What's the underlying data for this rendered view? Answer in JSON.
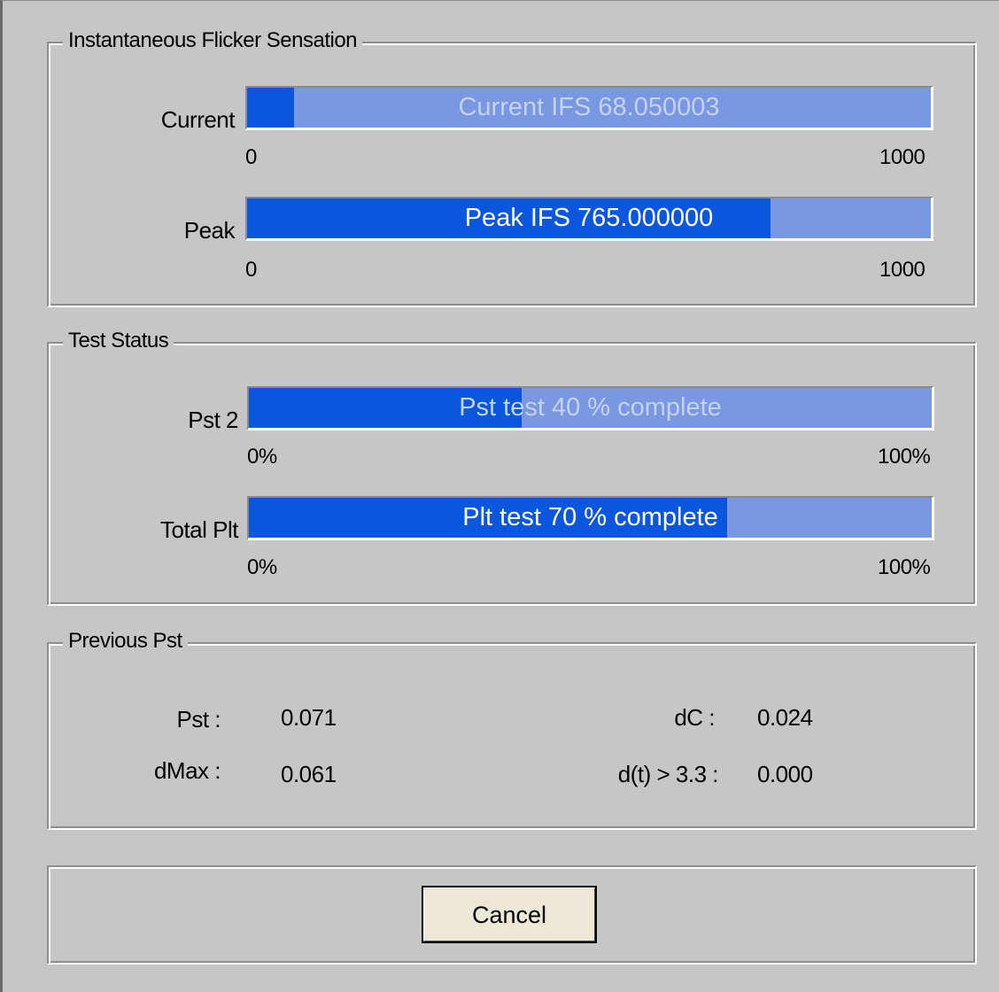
{
  "ifs_group": {
    "title": "Instantaneous Flicker Sensation",
    "current": {
      "label": "Current",
      "bar_text": "Current IFS 68.050003",
      "value": 68.050003,
      "scale_min": "0",
      "scale_max": "1000"
    },
    "peak": {
      "label": "Peak",
      "bar_text": "Peak IFS 765.000000",
      "value": 765.0,
      "scale_min": "0",
      "scale_max": "1000"
    }
  },
  "status_group": {
    "title": "Test Status",
    "pst": {
      "label": "Pst 2",
      "bar_text": "Pst test 40 % complete",
      "percent": 40,
      "scale_min": "0%",
      "scale_max": "100%"
    },
    "plt": {
      "label": "Total Plt",
      "bar_text": "Plt test 70 % complete",
      "percent": 70,
      "scale_min": "0%",
      "scale_max": "100%"
    }
  },
  "previous_group": {
    "title": "Previous Pst",
    "pst_label": "Pst :",
    "pst_value": "0.071",
    "dmax_label": "dMax :",
    "dmax_value": "0.061",
    "dc_label": "dC :",
    "dc_value": "0.024",
    "dt_label": "d(t) > 3.3 :",
    "dt_value": "0.000"
  },
  "actions": {
    "cancel_label": "Cancel"
  },
  "colors": {
    "bar_fill": "#0a56dc",
    "bar_track": "#7a98e2",
    "window_bg": "#c6c6c6"
  }
}
